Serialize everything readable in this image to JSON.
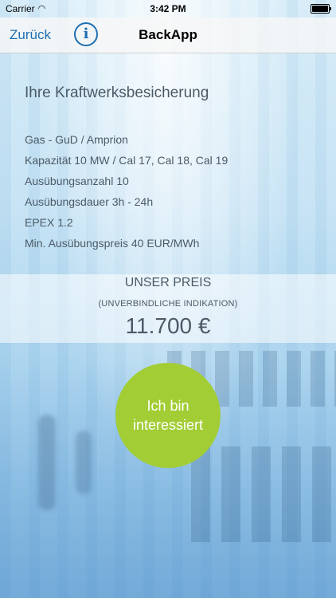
{
  "status_bar": {
    "carrier": "Carrier",
    "time": "3:42 PM"
  },
  "nav": {
    "back_label": "Zurück",
    "info_icon": "i",
    "title": "BackApp"
  },
  "product": {
    "title": "Ihre Kraftwerksbesicherung",
    "details": [
      "Gas - GuD / Amprion",
      "Kapazität 10 MW / Cal 17, Cal 18, Cal 19",
      "Ausübungsanzahl 10",
      "Ausübungsdauer 3h - 24h",
      "EPEX 1.2",
      "Min. Ausübungspreis 40 EUR/MWh"
    ]
  },
  "price": {
    "label": "UNSER PREIS",
    "note": "(UNVERBINDLICHE INDIKATION)",
    "value": "11.700 €"
  },
  "cta": {
    "label": "Ich bin interessiert",
    "color": "#a2cd35"
  },
  "colors": {
    "link": "#1f6fb2",
    "text": "#4b5a66"
  }
}
